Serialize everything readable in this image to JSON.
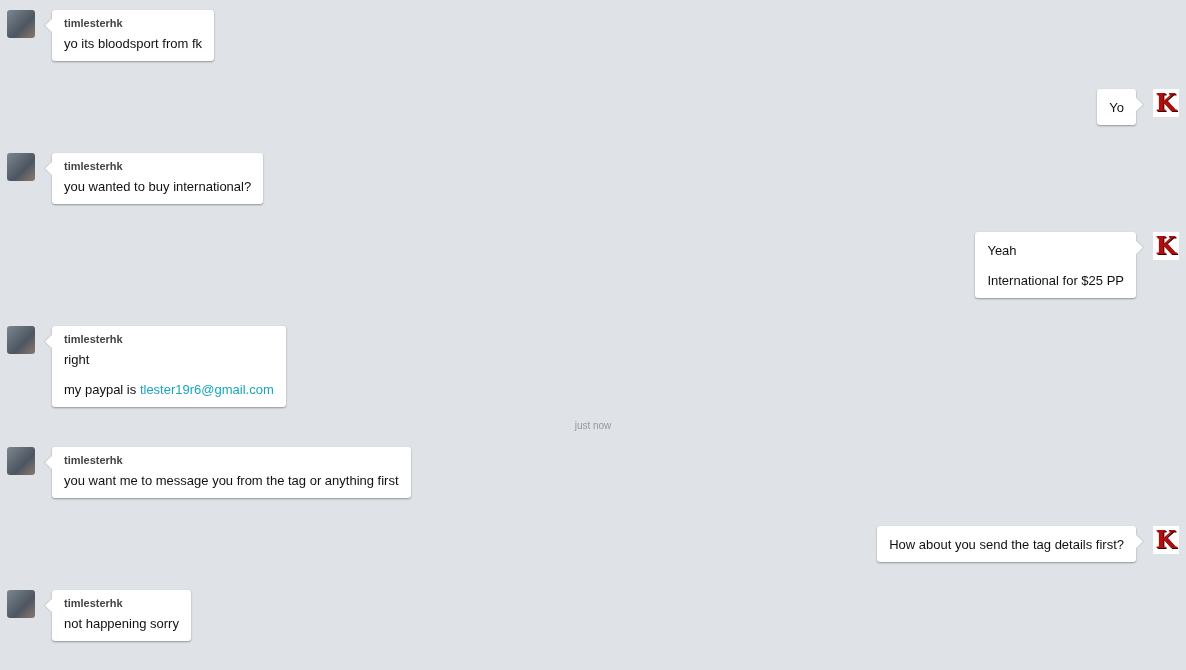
{
  "messages": [
    {
      "kind": "incoming",
      "sender": "timlesterhk",
      "lines": [
        {
          "text": "yo its bloodsport from fk"
        }
      ]
    },
    {
      "kind": "outgoing",
      "avatar_letter": "K",
      "lines": [
        {
          "text": "Yo"
        }
      ]
    },
    {
      "kind": "incoming",
      "sender": "timlesterhk",
      "lines": [
        {
          "text": "you wanted to buy international?"
        }
      ]
    },
    {
      "kind": "outgoing",
      "avatar_letter": "K",
      "lines": [
        {
          "text": "Yeah"
        },
        {
          "text": "International for $25 PP"
        }
      ]
    },
    {
      "kind": "incoming",
      "sender": "timlesterhk",
      "lines": [
        {
          "text": "right"
        },
        {
          "text": "my paypal is ",
          "link": "tlester19r6@gmail.com"
        }
      ]
    },
    {
      "kind": "timestamp",
      "text": "just now"
    },
    {
      "kind": "incoming",
      "sender": "timlesterhk",
      "lines": [
        {
          "text": "you want me to message you from the tag or anything first"
        }
      ]
    },
    {
      "kind": "outgoing",
      "avatar_letter": "K",
      "lines": [
        {
          "text": "How about you send the tag details first?"
        }
      ]
    },
    {
      "kind": "incoming",
      "sender": "timlesterhk",
      "lines": [
        {
          "text": "not happening sorry"
        }
      ]
    }
  ]
}
